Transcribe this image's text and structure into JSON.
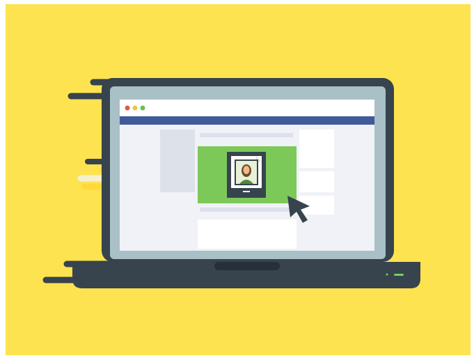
{
  "illustration": {
    "subject": "laptop-showing-social-feed-with-framed-portrait-post",
    "colors": {
      "background": "#fde34f",
      "laptop_body": "#37434d",
      "screen_bezel": "#a9c0c6",
      "screen_bg": "#f0f2f7",
      "nav_bar": "#3f5b99",
      "post_image": "#7cc95a",
      "placeholder": "#dde1ea",
      "card": "#ffffff",
      "cursor": "#37434d",
      "dot_red": "#e25845",
      "dot_yellow": "#f3c33c",
      "dot_green": "#6fbf4a",
      "indicator_light": "#6fd35a",
      "speed_line_yellow": "#ffd93b",
      "speed_line_light": "#f6f0cf"
    },
    "icons": [
      "window-dot-red-icon",
      "window-dot-yellow-icon",
      "window-dot-green-icon",
      "framed-portrait-icon",
      "mouse-cursor-icon",
      "power-indicator-icon"
    ]
  }
}
